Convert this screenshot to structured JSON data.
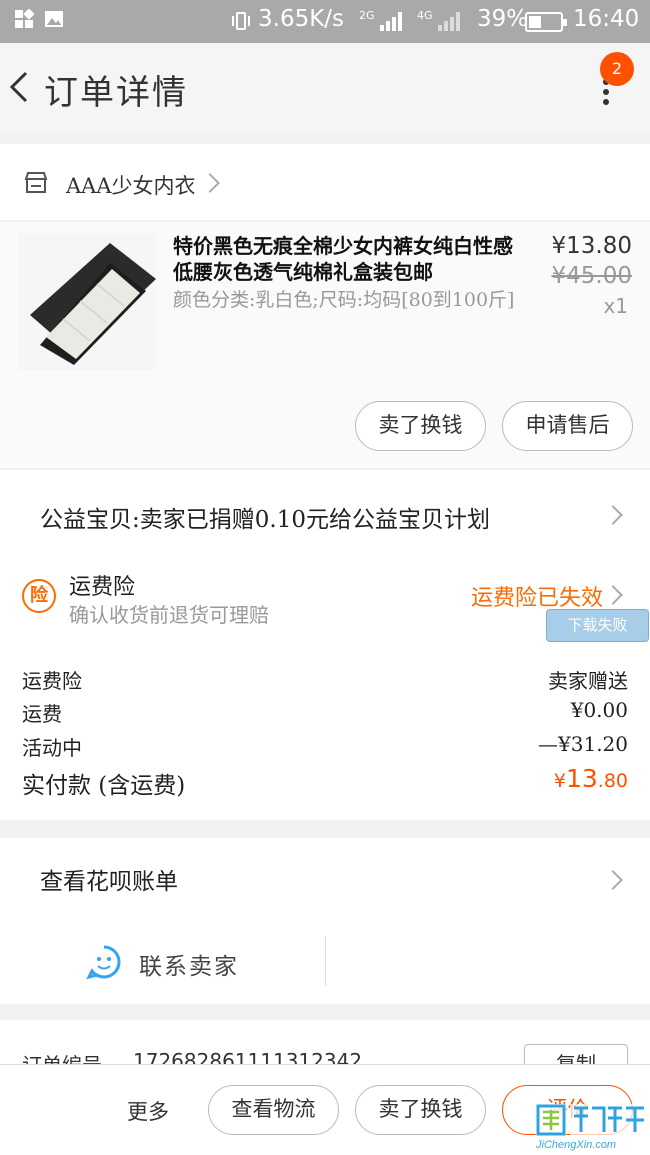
{
  "status_bar": {
    "speed": "3.65K/s",
    "net1": "2G",
    "net2": "4G",
    "battery": "39%",
    "battery_level": 0.39,
    "time": "16:40"
  },
  "header": {
    "title": "订单详情",
    "badge": "2"
  },
  "shop": {
    "name": "AAA少女内衣"
  },
  "product": {
    "title": "特价黑色无痕全棉少女内裤女纯白性感低腰灰色透气纯棉礼盒装包邮",
    "sku": "颜色分类:乳白色;尺码:均码[80到100斤]",
    "price": "¥13.80",
    "original_price": "¥45.00",
    "quantity": "x1",
    "actions": [
      "卖了换钱",
      "申请售后"
    ]
  },
  "charity": {
    "text": "公益宝贝:卖家已捐赠0.10元给公益宝贝计划"
  },
  "insurance": {
    "icon_char": "险",
    "title": "运费险",
    "subtitle": "确认收货前退货可理赔",
    "status": "运费险已失效",
    "toast": "下载失败"
  },
  "fees": [
    {
      "label": "运费险",
      "value": "卖家赠送"
    },
    {
      "label": "运费",
      "value": "¥0.00"
    },
    {
      "label": "活动中",
      "value": "—¥31.20"
    }
  ],
  "total": {
    "label": "实付款 (含运费)",
    "currency": "¥",
    "integer": "13",
    "decimal": ".80"
  },
  "huabei": {
    "text": "查看花呗账单"
  },
  "contact": {
    "label": "联系卖家"
  },
  "order": {
    "label": "订单编号",
    "number": "172682861111312342",
    "copy_label": "复制"
  },
  "bottom_bar": {
    "more": "更多",
    "buttons": [
      "查看物流",
      "卖了换钱",
      "评价"
    ]
  },
  "watermark": {
    "text": "JiChengXin.com"
  },
  "colors": {
    "accent": "#ff5000",
    "orange_text": "#ff6a00",
    "status_bar": "#a9a9a9"
  }
}
